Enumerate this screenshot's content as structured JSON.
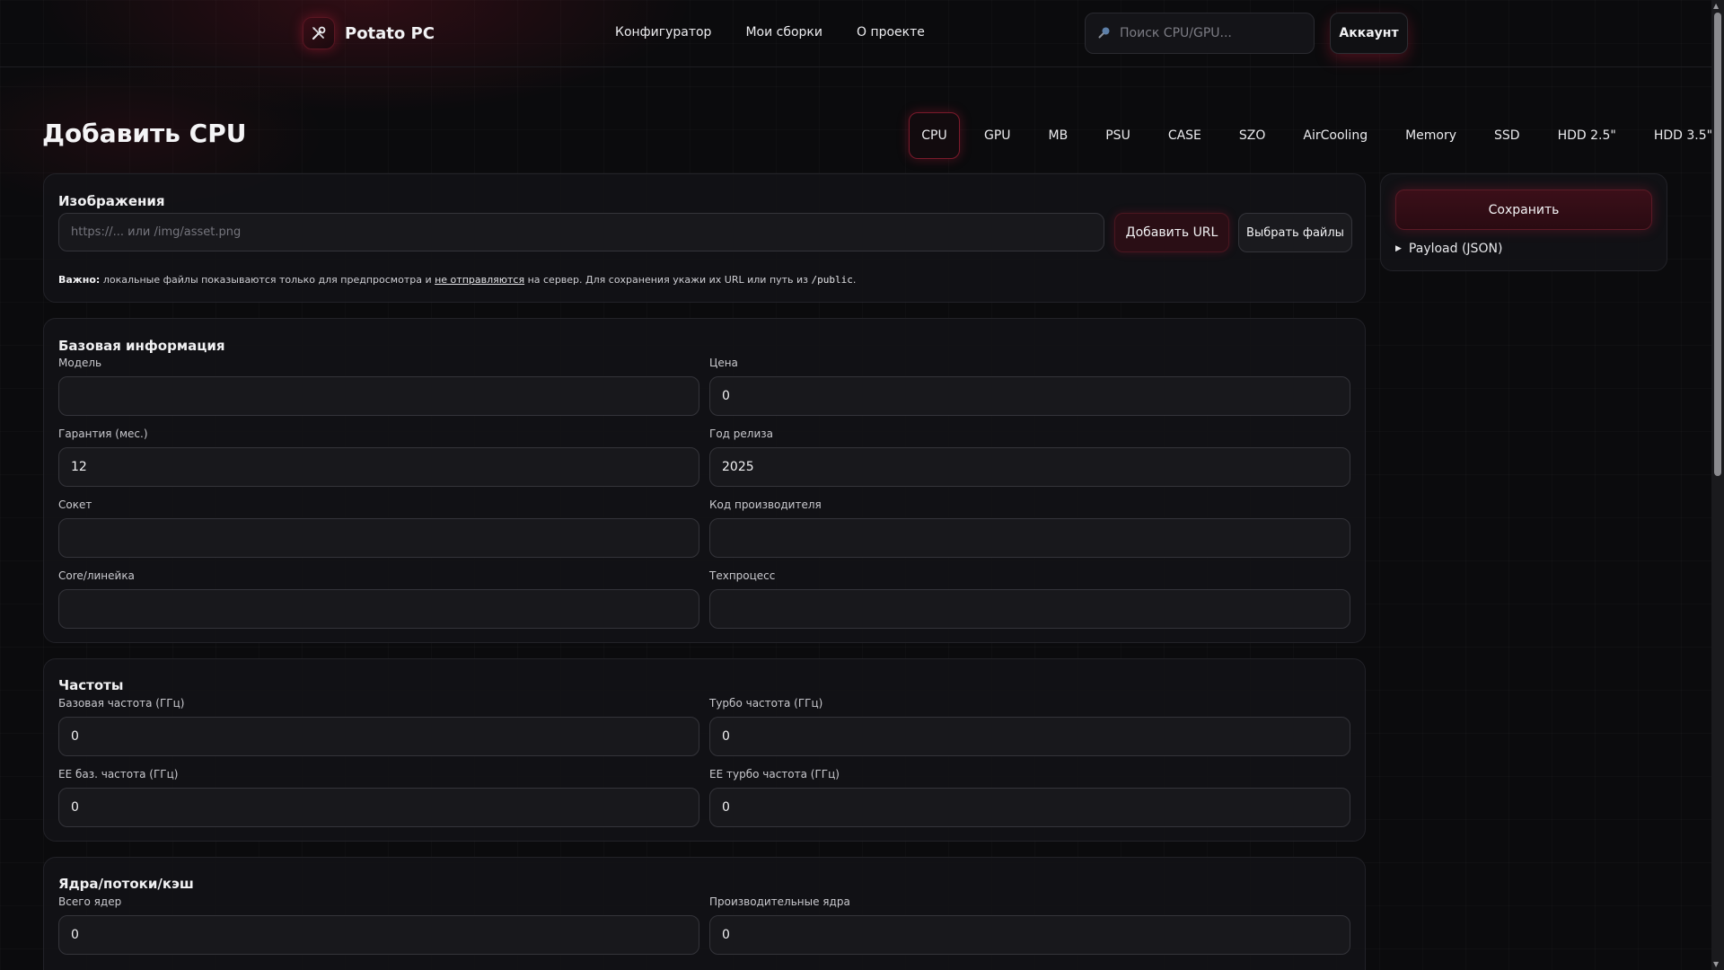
{
  "brand": {
    "name": "Potato PC"
  },
  "nav": [
    "Конфигуратор",
    "Мои сборки",
    "О проекте"
  ],
  "search": {
    "placeholder": "Поиск CPU/GPU..."
  },
  "account_label": "Аккаунт",
  "page_title": "Добавить CPU",
  "tabs": [
    "CPU",
    "GPU",
    "MB",
    "PSU",
    "CASE",
    "SZO",
    "AirCooling",
    "Memory",
    "SSD",
    "HDD 2.5\"",
    "HDD 3.5\""
  ],
  "active_tab": "CPU",
  "images": {
    "title": "Изображения",
    "url_placeholder": "https://... или /img/asset.png",
    "add_url_label": "Добавить URL",
    "choose_files_label": "Выбрать файлы",
    "note_bold": "Важно:",
    "note_part1": "локальные файлы показываются только для предпросмотра и",
    "note_link": "не отправляются",
    "note_part2": "на сервер. Для сохранения укажи их URL или путь из",
    "note_code": "/public",
    "note_end": "."
  },
  "base_info": {
    "title": "Базовая информация",
    "model_label": "Модель",
    "model_value": "",
    "price_label": "Цена",
    "price_value": "0",
    "warranty_label": "Гарантия (мес.)",
    "warranty_value": "12",
    "year_label": "Год релиза",
    "year_value": "2025",
    "socket_label": "Сокет",
    "socket_value": "",
    "mfr_code_label": "Код производителя",
    "mfr_code_value": "",
    "core_label": "Core/линейка",
    "core_value": "",
    "process_label": "Техпроцесс",
    "process_value": ""
  },
  "frequencies": {
    "title": "Частоты",
    "base_label": "Базовая частота (ГГц)",
    "base_value": "0",
    "turbo_label": "Турбо частота (ГГц)",
    "turbo_value": "0",
    "ee_base_label": "ЕЕ баз. частота (ГГц)",
    "ee_base_value": "0",
    "ee_turbo_label": "ЕЕ турбо частота (ГГц)",
    "ee_turbo_value": "0"
  },
  "cores": {
    "title": "Ядра/потоки/кэш",
    "total_label": "Всего ядер",
    "total_value": "0",
    "perf_label": "Производительные ядра",
    "perf_value": "0"
  },
  "side": {
    "save_label": "Сохранить",
    "payload_label": "Payload (JSON)"
  },
  "colors": {
    "accent": "#c8203c",
    "background": "#0b0b0d",
    "card": "#121216"
  }
}
